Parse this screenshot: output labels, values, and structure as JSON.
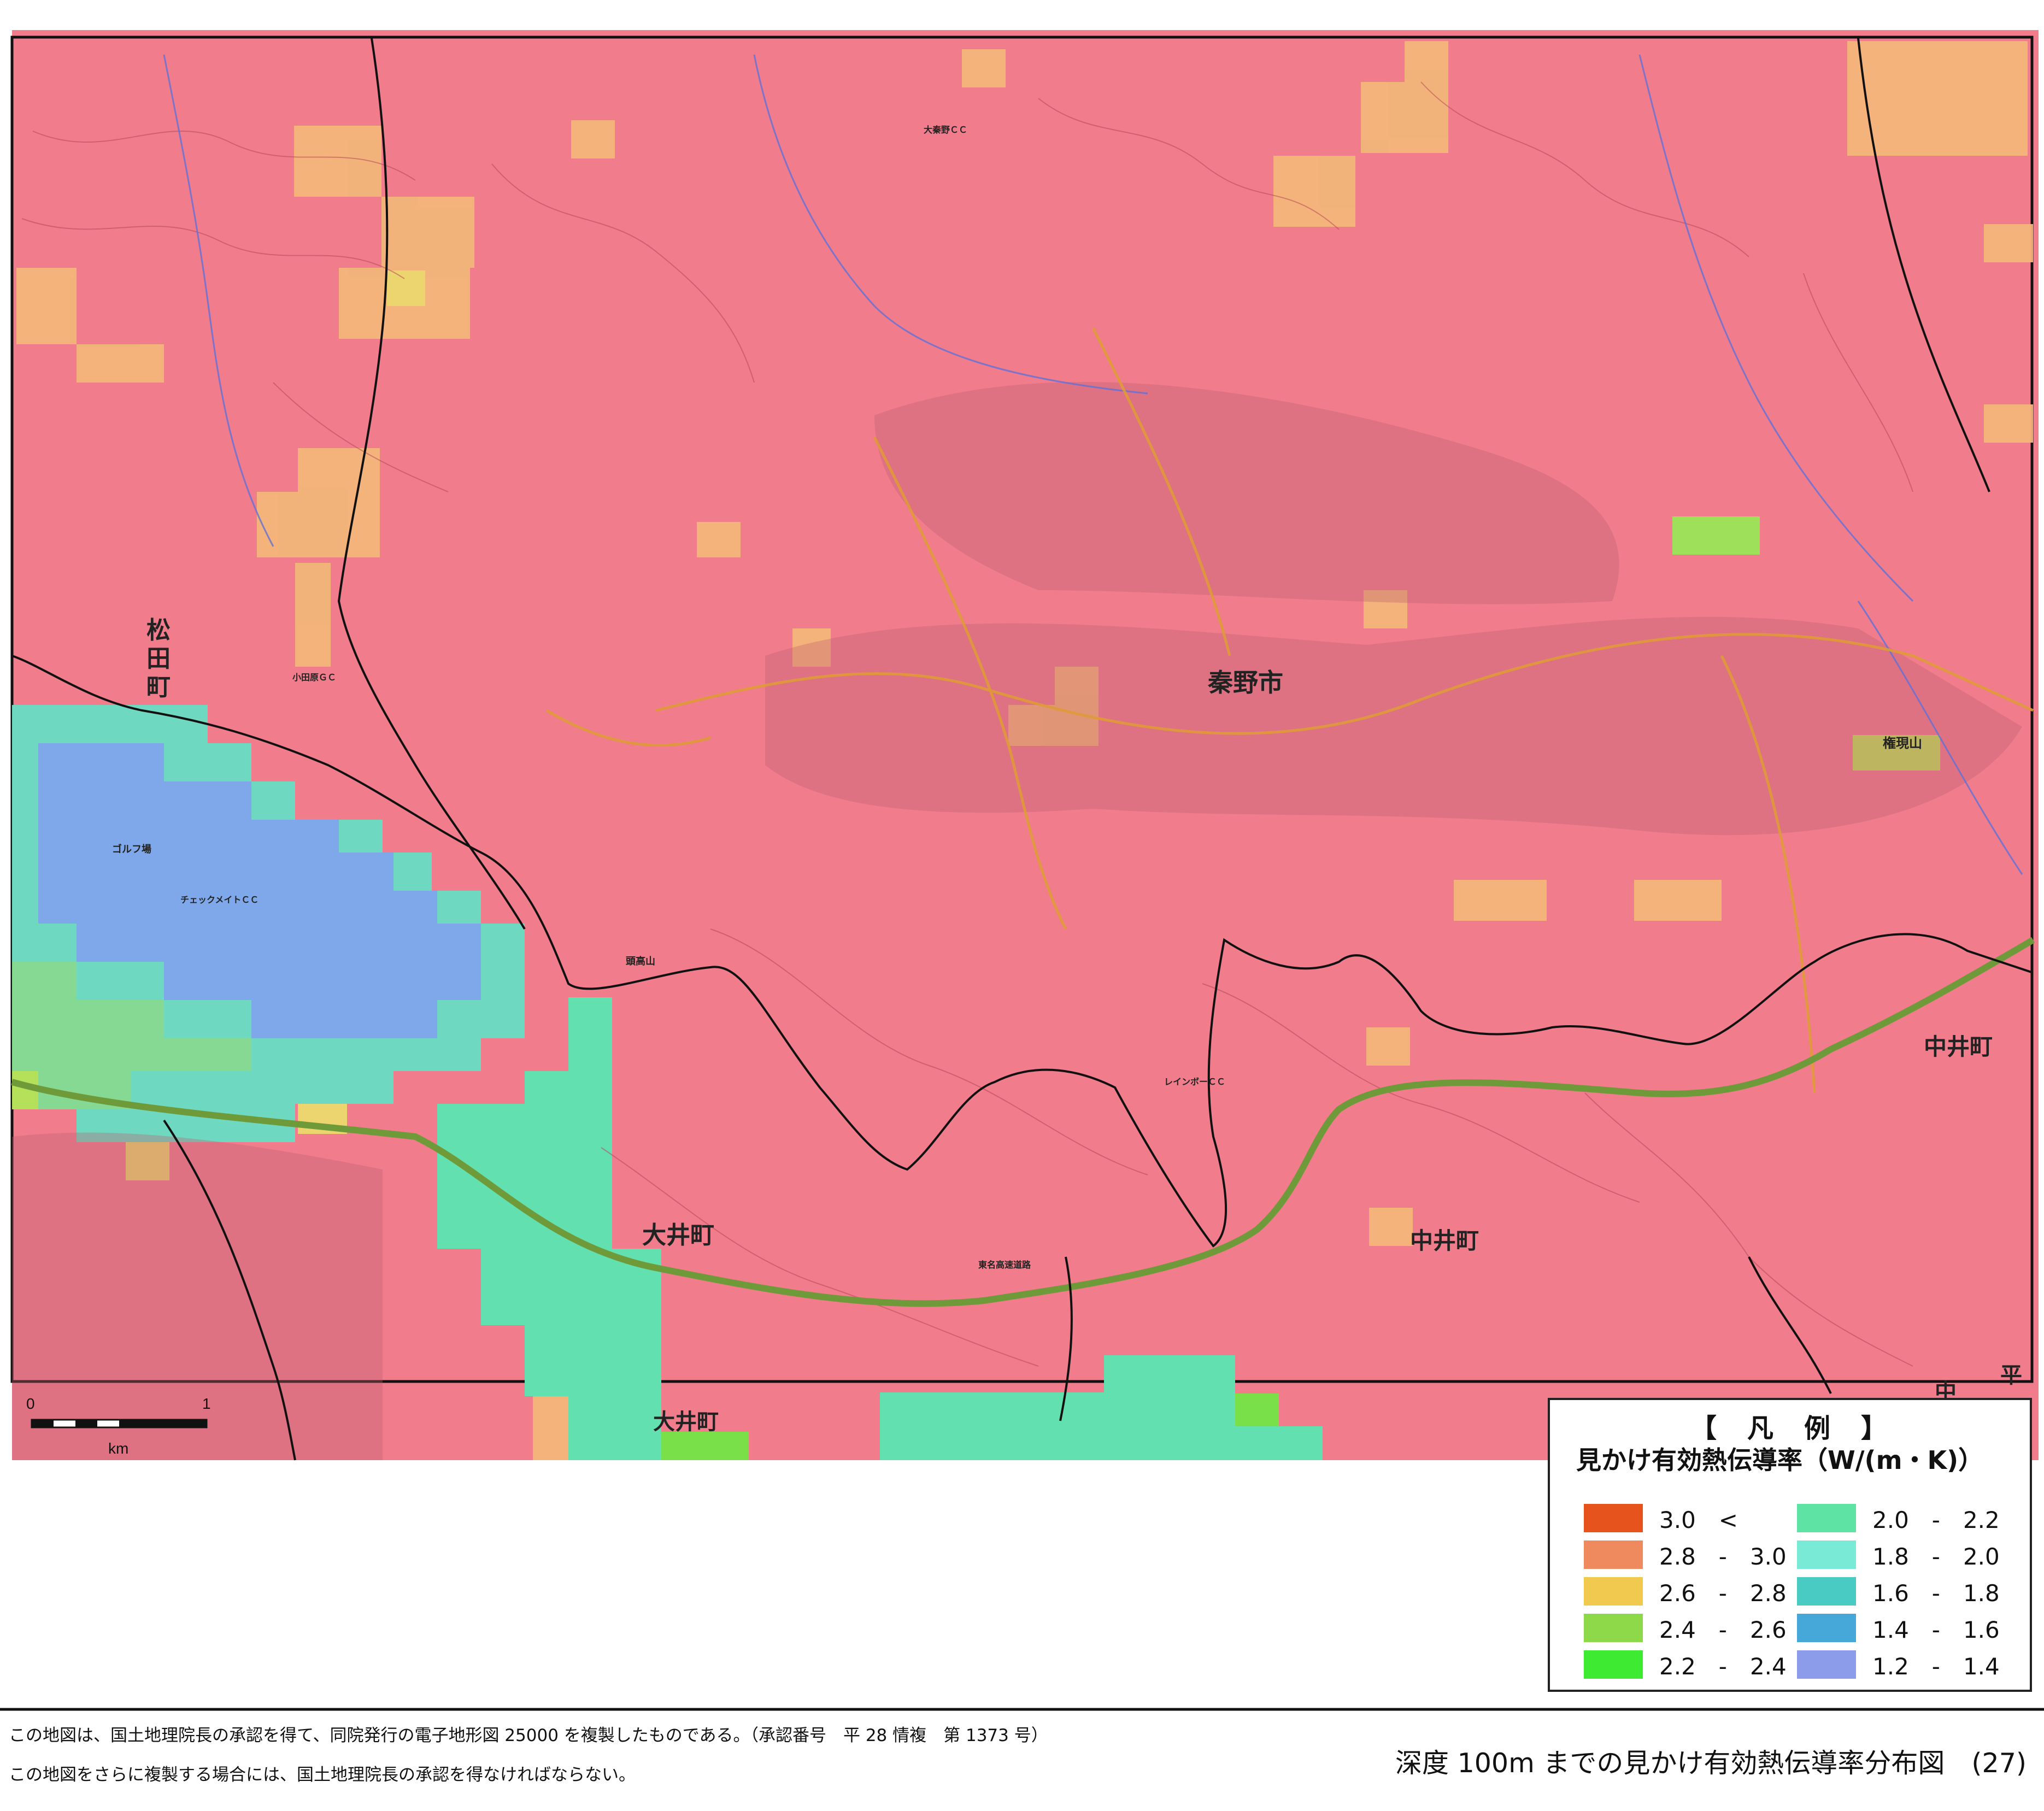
{
  "map": {
    "place_labels": [
      "松",
      "田",
      "町",
      "秦野市",
      "大井町",
      "中井町",
      "中井町",
      "大井町",
      "中",
      "平"
    ],
    "feature_labels": [
      "権現山",
      "ゴルフ場",
      "チェックメイトＣＣ",
      "小田原ＧＣ",
      "大秦野ＣＣ",
      "レインボーＣＣ",
      "東名高速道路",
      "頭高山",
      "大井町"
    ],
    "scale_bar": {
      "start": "0",
      "end": "1",
      "unit": "km"
    }
  },
  "legend": {
    "title": "【　凡　例　】",
    "subtitle": "見かけ有効熱伝導率（W/(m・K)）",
    "items": [
      {
        "label": "3.0　<",
        "color": "#e6531c"
      },
      {
        "label": "2.8　-　3.0",
        "color": "#ee8a5e"
      },
      {
        "label": "2.6　-　2.8",
        "color": "#f1c94f"
      },
      {
        "label": "2.4　-　2.6",
        "color": "#8dd94a"
      },
      {
        "label": "2.2　-　2.4",
        "color": "#3fea32"
      },
      {
        "label": "2.0　-　2.2",
        "color": "#5fe3a5"
      },
      {
        "label": "1.8　-　2.0",
        "color": "#78ead6"
      },
      {
        "label": "1.6　-　1.8",
        "color": "#49cbc3"
      },
      {
        "label": "1.4　-　1.6",
        "color": "#46a8d9"
      },
      {
        "label": "1.2　-　1.4",
        "color": "#8c9bea"
      }
    ]
  },
  "colors": {
    "base_pink": "#f07c8c",
    "orange_cell": "#f3b67a",
    "yellow_cell": "#ecd46e",
    "green_cell": "#a8e05a",
    "bright_green_cell": "#5fe04a",
    "aqua_cell": "#63e0b0",
    "teal_cell": "#6ad0c8",
    "blue_cell": "#7fa8ea",
    "highway": "#6f9a3a",
    "road": "#e09a38",
    "boundary": "#111111"
  },
  "footer": {
    "note1": "この地図は、国土地理院長の承認を得て、同院発行の電子地形図 25000 を複製したものである。（承認番号　平 28 情複　第 1373 号）",
    "note2": "この地図をさらに複製する場合には、国土地理院長の承認を得なければならない。",
    "title": "深度 100m までの見かけ有効熱伝導率分布図　(27)"
  }
}
